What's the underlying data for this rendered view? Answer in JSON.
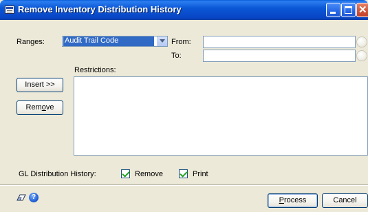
{
  "window": {
    "title": "Remove Inventory Distribution History",
    "title_icon": "window-app-icon",
    "controls": [
      "minimize-icon",
      "maximize-icon",
      "close-icon"
    ]
  },
  "ranges": {
    "label": "Ranges:",
    "selected": "Audit Trail Code",
    "from_label": "From:",
    "to_label": "To:",
    "from_value": "",
    "to_value": ""
  },
  "restrictions": {
    "label": "Restrictions:",
    "items": []
  },
  "buttons": {
    "insert": "Insert >>",
    "remove_pre": "Rem",
    "remove_u": "o",
    "remove_post": "ve",
    "process_u": "P",
    "process_post": "rocess",
    "cancel": "Cancel"
  },
  "gl_distribution": {
    "label": "GL Distribution History:",
    "remove_label": "Remove",
    "remove_checked": true,
    "print_label": "Print",
    "print_checked": true
  },
  "colors": {
    "titlebar": "#0b58d6",
    "window_bg": "#ece9d8",
    "selection": "#316ac5",
    "field_border": "#7f9db9"
  }
}
